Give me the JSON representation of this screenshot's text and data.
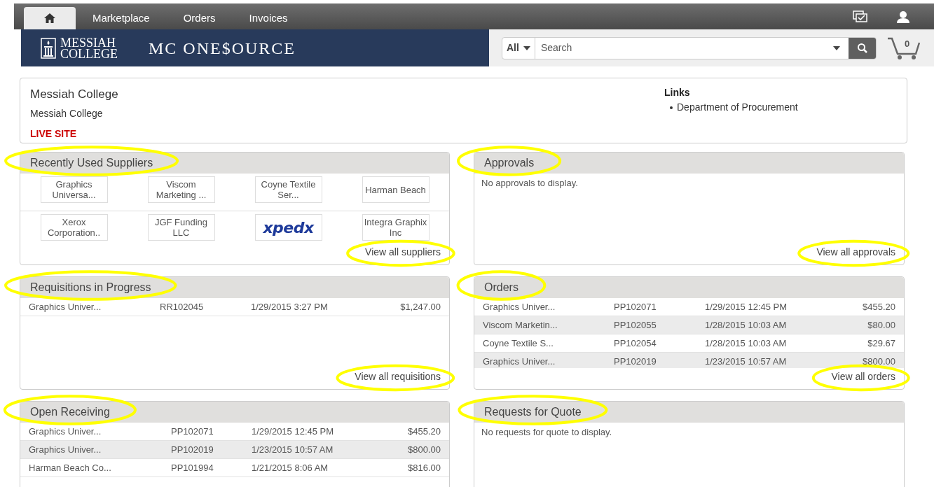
{
  "nav": {
    "tabs": [
      {
        "kind": "home",
        "selected": true
      },
      {
        "kind": "text",
        "label": "Marketplace",
        "selected": false
      },
      {
        "kind": "text",
        "label": "Orders",
        "selected": false
      },
      {
        "kind": "text",
        "label": "Invoices",
        "selected": false
      }
    ]
  },
  "banner": {
    "org_name_lines": [
      "MESSIAH",
      "COLLEGE"
    ],
    "app_name": "MC ONE$OURCE"
  },
  "search": {
    "scope": "All",
    "placeholder": "Search"
  },
  "cart": {
    "count": "0"
  },
  "info": {
    "title": "Messiah College",
    "subtitle": "Messiah College",
    "status": "LIVE SITE",
    "links_heading": "Links",
    "links": [
      "Department of Procurement"
    ]
  },
  "panels": [
    {
      "kind": "suppliers",
      "title": "Recently Used Suppliers",
      "title_circled": true,
      "link": "View all suppliers",
      "link_circled": true,
      "suppliers": [
        {
          "kind": "text",
          "name": "Graphics Universa..."
        },
        {
          "kind": "text",
          "name": "Viscom Marketing ..."
        },
        {
          "kind": "text",
          "name": "Coyne Textile Ser..."
        },
        {
          "kind": "text",
          "name": "Harman Beach"
        },
        {
          "kind": "text",
          "name": "Xerox Corporation.."
        },
        {
          "kind": "text",
          "name": "JGF Funding LLC"
        },
        {
          "kind": "logo",
          "name": "xpedx"
        },
        {
          "kind": "text",
          "name": "Integra Graphix Inc"
        }
      ]
    },
    {
      "kind": "empty",
      "title": "Approvals",
      "title_circled": true,
      "message": "No approvals to display.",
      "link": "View all approvals",
      "link_circled": true
    },
    {
      "kind": "table",
      "title": "Requisitions in Progress",
      "title_circled": true,
      "link": "View all requisitions",
      "link_circled": true,
      "rows": [
        [
          "Graphics Univer...",
          "RR102045",
          "1/29/2015 3:27 PM",
          "$1,247.00"
        ]
      ]
    },
    {
      "kind": "table",
      "title": "Orders",
      "title_circled": true,
      "link": "View all orders",
      "link_circled": true,
      "rows": [
        [
          "Graphics Univer...",
          "PP102071",
          "1/29/2015 12:45 PM",
          "$455.20"
        ],
        [
          "Viscom Marketin...",
          "PP102055",
          "1/28/2015 10:03 AM",
          "$80.00"
        ],
        [
          "Coyne Textile S...",
          "PP102054",
          "1/28/2015 10:03 AM",
          "$29.67"
        ],
        [
          "Graphics Univer...",
          "PP102019",
          "1/23/2015 10:57 AM",
          "$800.00"
        ]
      ]
    },
    {
      "kind": "table",
      "title": "Open Receiving",
      "title_circled": true,
      "rows": [
        [
          "Graphics Univer...",
          "PP102071",
          "1/29/2015 12:45 PM",
          "$455.20"
        ],
        [
          "Graphics Univer...",
          "PP102019",
          "1/23/2015 10:57 AM",
          "$800.00"
        ],
        [
          "Harman Beach Co...",
          "PP101994",
          "1/21/2015 8:06 AM",
          "$816.00"
        ]
      ]
    },
    {
      "kind": "empty",
      "title": "Requests for Quote",
      "title_circled": true,
      "message": "No requests for quote to display."
    }
  ]
}
